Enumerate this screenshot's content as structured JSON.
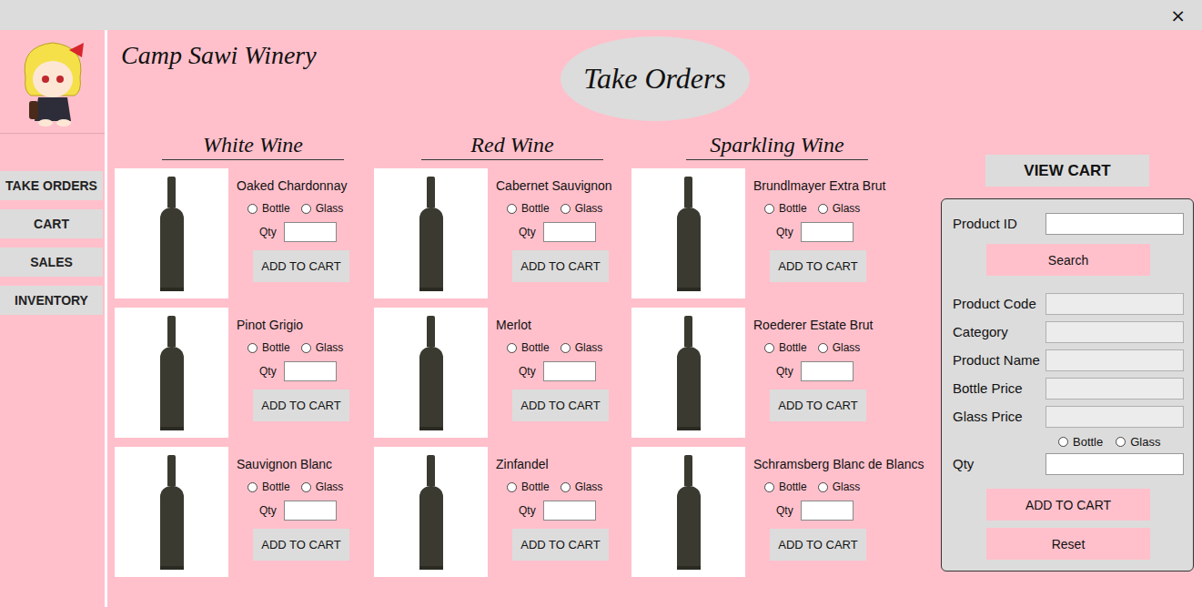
{
  "window": {
    "close": "×"
  },
  "sidebar": {
    "logo_alt": "",
    "items": [
      {
        "label": "TAKE ORDERS"
      },
      {
        "label": "CART"
      },
      {
        "label": "SALES"
      },
      {
        "label": "INVENTORY"
      }
    ]
  },
  "brand": "Camp Sawi Winery",
  "page_title": "Take Orders",
  "categories": [
    {
      "title": "White Wine",
      "products": [
        {
          "name": "Oaked Chardonnay",
          "options": [
            {
              "label": "Bottle",
              "selected": false
            },
            {
              "label": "Glass",
              "selected": false
            }
          ],
          "qty_label": "Qty",
          "qty": "",
          "button": "ADD TO CART"
        },
        {
          "name": "Pinot Grigio",
          "options": [
            {
              "label": "Bottle",
              "selected": false
            },
            {
              "label": "Glass",
              "selected": false
            }
          ],
          "qty_label": "Qty",
          "qty": "",
          "button": "ADD TO CART"
        },
        {
          "name": "Sauvignon Blanc",
          "options": [
            {
              "label": "Bottle",
              "selected": false
            },
            {
              "label": "Glass",
              "selected": false
            }
          ],
          "qty_label": "Qty",
          "qty": "",
          "button": "ADD TO CART"
        }
      ]
    },
    {
      "title": "Red Wine",
      "products": [
        {
          "name": "Cabernet Sauvignon",
          "options": [
            {
              "label": "Bottle",
              "selected": false
            },
            {
              "label": "Glass",
              "selected": false
            }
          ],
          "qty_label": "Qty",
          "qty": "",
          "button": "ADD TO CART"
        },
        {
          "name": "Merlot",
          "options": [
            {
              "label": "Bottle",
              "selected": false
            },
            {
              "label": "Glass",
              "selected": false
            }
          ],
          "qty_label": "Qty",
          "qty": "",
          "button": "ADD TO CART"
        },
        {
          "name": "Zinfandel",
          "options": [
            {
              "label": "Bottle",
              "selected": false
            },
            {
              "label": "Glass",
              "selected": false
            }
          ],
          "qty_label": "Qty",
          "qty": "",
          "button": "ADD TO CART"
        }
      ]
    },
    {
      "title": "Sparkling Wine",
      "products": [
        {
          "name": "Brundlmayer Extra Brut",
          "options": [
            {
              "label": "Bottle",
              "selected": false
            },
            {
              "label": "Glass",
              "selected": false
            }
          ],
          "qty_label": "Qty",
          "qty": "",
          "button": "ADD TO CART"
        },
        {
          "name": "Roederer Estate Brut",
          "options": [
            {
              "label": "Bottle",
              "selected": false
            },
            {
              "label": "Glass",
              "selected": false
            }
          ],
          "qty_label": "Qty",
          "qty": "",
          "button": "ADD TO CART"
        },
        {
          "name": "Schramsberg Blanc de Blancs",
          "options": [
            {
              "label": "Bottle",
              "selected": false
            },
            {
              "label": "Glass",
              "selected": false
            }
          ],
          "qty_label": "Qty",
          "qty": "",
          "button": "ADD TO CART"
        }
      ]
    }
  ],
  "cart_panel": {
    "view_cart": "VIEW CART",
    "search_field": {
      "label": "Product ID",
      "value": ""
    },
    "search_button": "Search",
    "fields": [
      {
        "label": "Product Code",
        "value": ""
      },
      {
        "label": "Category",
        "value": ""
      },
      {
        "label": "Product Name",
        "value": ""
      },
      {
        "label": "Bottle Price",
        "value": ""
      },
      {
        "label": "Glass Price",
        "value": ""
      }
    ],
    "options": [
      {
        "label": "Bottle",
        "selected": false
      },
      {
        "label": "Glass",
        "selected": false
      }
    ],
    "qty": {
      "label": "Qty",
      "value": ""
    },
    "buttons": [
      "ADD TO CART",
      "Reset"
    ]
  }
}
